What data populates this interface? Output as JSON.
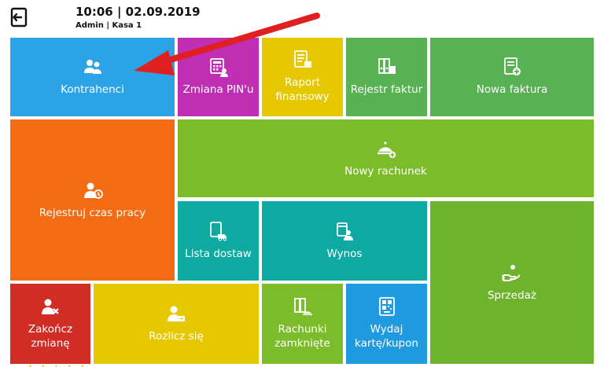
{
  "header": {
    "datetime": "10:06 | 02.09.2019",
    "user_info": "Admin | Kasa 1"
  },
  "tiles": [
    {
      "id": "kontrahenci",
      "label": "Kontrahenci",
      "color": "#2ba3e6",
      "icon": "contacts-icon"
    },
    {
      "id": "zmiana-pin",
      "label": "Zmiana PIN'u",
      "color": "#c02fb3",
      "icon": "pin-keypad-icon"
    },
    {
      "id": "raport-finansowy",
      "label": "Raport\nfinansowy",
      "color": "#e6c800",
      "icon": "report-icon"
    },
    {
      "id": "rejestr-faktur",
      "label": "Rejestr faktur",
      "color": "#58b153",
      "icon": "binders-icon"
    },
    {
      "id": "nowa-faktura",
      "label": "Nowa faktura",
      "color": "#58b153",
      "icon": "new-invoice-icon"
    },
    {
      "id": "rejestruj-czas-pracy",
      "label": "Rejestruj czas pracy",
      "color": "#f36b12",
      "icon": "worker-clock-icon"
    },
    {
      "id": "nowy-rachunek",
      "label": "Nowy rachunek",
      "color": "#7cbb2a",
      "icon": "cloche-plus-icon"
    },
    {
      "id": "lista-dostaw",
      "label": "Lista dostaw",
      "color": "#0eaaa2",
      "icon": "delivery-icon"
    },
    {
      "id": "wynos",
      "label": "Wynos",
      "color": "#0eaaa2",
      "icon": "takeaway-icon"
    },
    {
      "id": "sprzedaz",
      "label": "Sprzedaż",
      "color": "#6db32b",
      "icon": "hand-coin-icon"
    },
    {
      "id": "zakoncz-zmiane",
      "label": "Zakończ\nzmianę",
      "color": "#d02e25",
      "icon": "user-remove-icon"
    },
    {
      "id": "rozlicz-sie",
      "label": "Rozlicz się",
      "color": "#e6c800",
      "icon": "user-settle-icon"
    },
    {
      "id": "rachunki-zamkniete",
      "label": "Rachunki\nzamknięte",
      "color": "#7cbb2a",
      "icon": "closed-bills-icon"
    },
    {
      "id": "wydaj-karte-kupon",
      "label": "Wydaj\nkartę/kupon",
      "color": "#1e9be0",
      "icon": "qr-card-icon"
    }
  ],
  "accent": {
    "arrow_color": "#e02020",
    "star_color": "#f0b400"
  }
}
